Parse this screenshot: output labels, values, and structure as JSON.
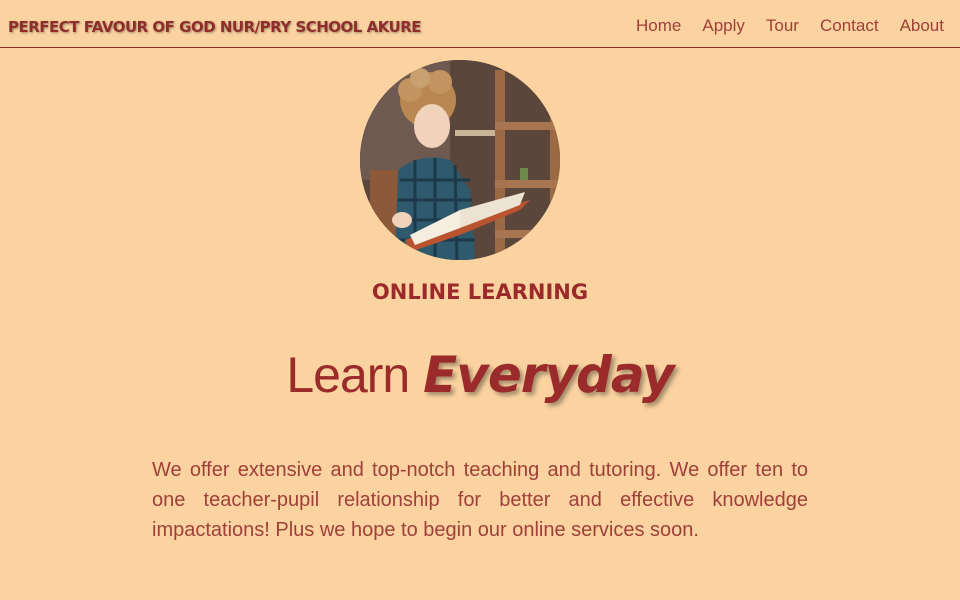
{
  "header": {
    "school_name": "PERFECT FAVOUR OF GOD NUR/PRY SCHOOL AKURE",
    "nav": [
      {
        "label": "Home"
      },
      {
        "label": "Apply"
      },
      {
        "label": "Tour"
      },
      {
        "label": "Contact"
      },
      {
        "label": "About"
      }
    ]
  },
  "hero": {
    "image_subject": "child reading a book",
    "eyebrow": "ONLINE LEARNING",
    "headline_light": "Learn",
    "headline_bold": "Everyday",
    "body": "We offer extensive and top-notch teaching and tutoring. We offer ten to one teacher-pupil relationship for better and effective knowledge impactations! Plus we hope to begin our online services soon."
  },
  "colors": {
    "background": "#fad3a0",
    "accent": "#9b2a2a",
    "nav_text": "#a0403a"
  }
}
